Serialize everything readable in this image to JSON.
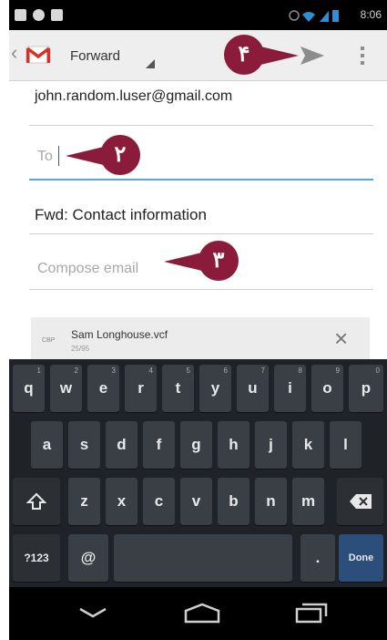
{
  "status_bar": {
    "time": "8:06"
  },
  "action_bar": {
    "title": "Forward",
    "icons": [
      "back-chevron-icon",
      "gmail-icon",
      "send-icon",
      "overflow-menu-icon"
    ]
  },
  "callouts": {
    "send": "۴",
    "to": "۲",
    "compose": "۳"
  },
  "form": {
    "from": "john.random.luser@gmail.com",
    "to_placeholder": "To",
    "subject": "Fwd: Contact information",
    "compose_placeholder": "Compose email"
  },
  "attachment": {
    "type_badge": "CBP",
    "filename": "Sam Longhouse.vcf",
    "size": "25/95"
  },
  "keyboard": {
    "row1": [
      "q",
      "w",
      "e",
      "r",
      "t",
      "y",
      "u",
      "i",
      "o",
      "p"
    ],
    "row1_hints": [
      "1",
      "2",
      "3",
      "4",
      "5",
      "6",
      "7",
      "8",
      "9",
      "0"
    ],
    "row2": [
      "a",
      "s",
      "d",
      "f",
      "g",
      "h",
      "j",
      "k",
      "l"
    ],
    "row3": [
      "z",
      "x",
      "c",
      "v",
      "b",
      "n",
      "m"
    ],
    "symbols_label": "?123",
    "at_label": "@",
    "period_label": ".",
    "done_label": "Done"
  },
  "colors": {
    "callout": "#8b1b3a",
    "focus_line": "#5aa6d8",
    "gmail_red": "#d93025"
  }
}
